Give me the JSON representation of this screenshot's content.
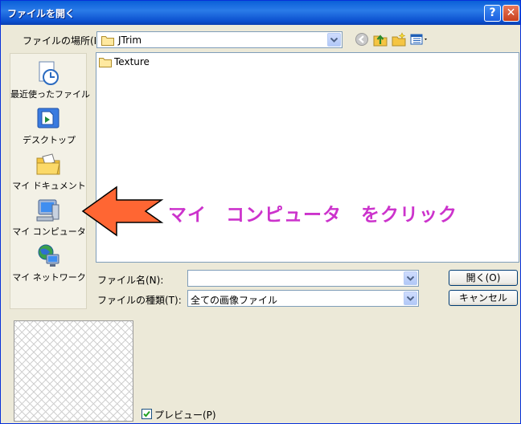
{
  "window": {
    "title": "ファイルを開く",
    "help": "?",
    "close": "✕"
  },
  "lookin": {
    "label": "ファイルの場所(I):",
    "value": "JTrim"
  },
  "toolbar": {
    "back_icon": "back-icon",
    "up_icon": "up-folder-icon",
    "new_icon": "new-folder-icon",
    "view_icon": "view-menu-icon"
  },
  "places": [
    {
      "label": "最近使ったファイル",
      "icon": "recent-icon"
    },
    {
      "label": "デスクトップ",
      "icon": "desktop-icon"
    },
    {
      "label": "マイ ドキュメント",
      "icon": "my-documents-icon"
    },
    {
      "label": "マイ コンピュータ",
      "icon": "my-computer-icon"
    },
    {
      "label": "マイ ネットワーク",
      "icon": "my-network-icon"
    }
  ],
  "files": [
    {
      "name": "Texture",
      "type": "folder"
    }
  ],
  "filename": {
    "label": "ファイル名(N):",
    "value": ""
  },
  "filetype": {
    "label": "ファイルの種類(T):",
    "value": "全ての画像ファイル"
  },
  "buttons": {
    "open": "開く(O)",
    "cancel": "キャンセル"
  },
  "preview": {
    "checkbox_label": "プレビュー(P)",
    "checked": true
  },
  "annotation": {
    "text": "マイ　コンピュータ　をクリック",
    "color": "#cc33cc",
    "arrow_color": "#ff6633"
  }
}
